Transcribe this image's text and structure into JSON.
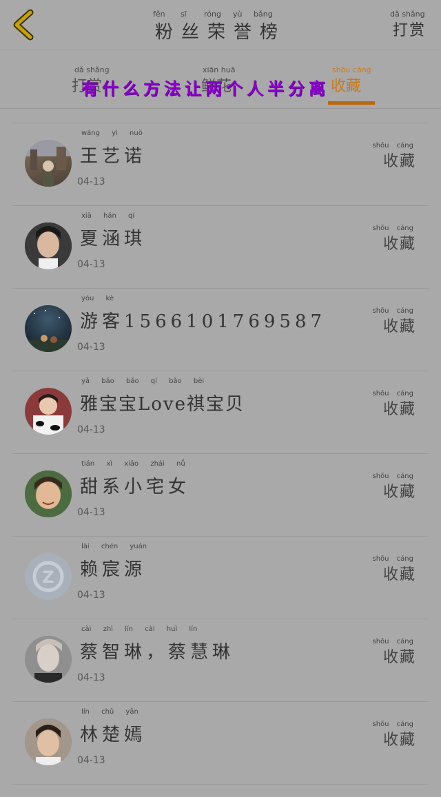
{
  "header": {
    "title": "粉丝荣誉榜",
    "title_pinyin": [
      "fěn",
      "sī",
      "róng",
      "yù",
      "bǎng"
    ],
    "reward": "打赏",
    "reward_pinyin": "dǎ  shǎng"
  },
  "tabs": {
    "items": [
      {
        "label": "打赏",
        "pinyin": "dǎ  shǎng",
        "active": false
      },
      {
        "label": "鲜花",
        "pinyin": "xiān  huā",
        "active": false
      },
      {
        "label": "收藏",
        "pinyin": "shōu  cáng",
        "active": true
      }
    ],
    "overlay_caption": "有什么方法让两个人半分离"
  },
  "list": [
    {
      "name": "王艺诺",
      "pinyin": "wáng  yì  nuò",
      "date": "04-13",
      "action": "收藏",
      "action_pinyin": "shōu cáng",
      "avatar": "photo-street"
    },
    {
      "name": "夏涵琪",
      "pinyin": "xià  hán  qí",
      "date": "04-13",
      "action": "收藏",
      "action_pinyin": "shōu cáng",
      "avatar": "photo-girl"
    },
    {
      "name": "游客15661017695​87",
      "pinyin": "yóu  kè",
      "date": "04-13",
      "action": "收藏",
      "action_pinyin": "shōu cáng",
      "avatar": "photo-night-sky"
    },
    {
      "name": "雅宝宝Love祺宝贝",
      "pinyin": "yǎ  bǎo  bǎo        qí  bǎo  bèi",
      "date": "04-13",
      "action": "收藏",
      "action_pinyin": "shōu cáng",
      "avatar": "photo-cow-print"
    },
    {
      "name": "甜系小宅女",
      "pinyin": "tián  xì  xiǎo  zhái  nǚ",
      "date": "04-13",
      "action": "收藏",
      "action_pinyin": "shōu cáng",
      "avatar": "photo-boy-smile"
    },
    {
      "name": "赖宸源",
      "pinyin": "lài  chén  yuán",
      "date": "04-13",
      "action": "收藏",
      "action_pinyin": "shōu cáng",
      "avatar": "qq-default"
    },
    {
      "name": "蔡智琳，蔡慧琳",
      "pinyin": "cài  zhì  lín    cài  huì  lín",
      "date": "04-13",
      "action": "收藏",
      "action_pinyin": "shōu cáng",
      "avatar": "photo-man-pale"
    },
    {
      "name": "林楚嫣",
      "pinyin": "lín  chǔ  yān",
      "date": "04-13",
      "action": "收藏",
      "action_pinyin": "shōu cáng",
      "avatar": "photo-young-man"
    }
  ],
  "colors": {
    "background": "#a9a9a9",
    "active_tab": "#c77a1a",
    "overlay_caption": "#8a00c8",
    "back_arrow": "#c9a200"
  }
}
